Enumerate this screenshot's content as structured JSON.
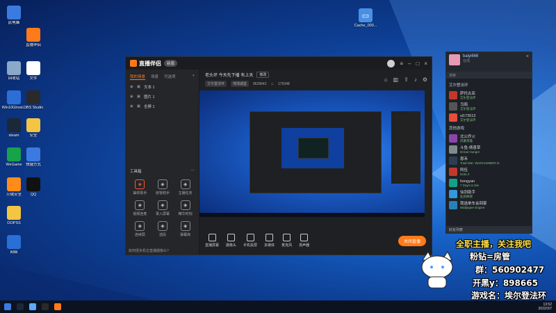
{
  "desktop": {
    "icons_left": [
      {
        "label": "此电脑",
        "color": "#3b7be0"
      },
      {
        "label": "回收站",
        "color": "#8aa8c8"
      },
      {
        "label": "Win10Ghost...",
        "color": "#2b6fd6"
      },
      {
        "label": "steam",
        "color": "#1b2838"
      },
      {
        "label": "WeGame",
        "color": "#16a34a"
      },
      {
        "label": "火绒安全",
        "color": "#ff8c1a"
      },
      {
        "label": "OOPSS",
        "color": "#f4c542"
      },
      {
        "label": "网络",
        "color": "#2a6fd6"
      }
    ],
    "icons_right": [
      {
        "label": "直播伴侣",
        "color": "#ff7a1a"
      },
      {
        "label": "文件",
        "color": "#ffffff"
      },
      {
        "label": "OBS Studio",
        "color": "#2a2a2a"
      },
      {
        "label": "安全",
        "color": "#f4c542"
      },
      {
        "label": "快捷方式",
        "color": "#3b7be0"
      },
      {
        "label": "QQ",
        "color": "#111111"
      }
    ],
    "top_file": "Cache_000..."
  },
  "app": {
    "name": "直播伴侣",
    "version": "新版",
    "left_tabs": [
      "我的场景",
      "场景",
      "可选项"
    ],
    "scenes": [
      "文本 1",
      "图片 1",
      "全屏 1"
    ],
    "tools_title": "工具箱",
    "tools": [
      {
        "label": "抽奖助手",
        "hot": true
      },
      {
        "label": "房管助手",
        "hot": false
      },
      {
        "label": "主播任务",
        "hot": false
      },
      {
        "label": "视频连麦",
        "hot": false
      },
      {
        "label": "录入屏幕",
        "hot": false
      },
      {
        "label": "精华时刻",
        "hot": false
      },
      {
        "label": "连续屏",
        "hot": false
      },
      {
        "label": "选段",
        "hot": false
      },
      {
        "label": "弹幕库",
        "hot": false
      }
    ],
    "notice": "如何把多机位直播摄像头?",
    "room_title": "老头环 今天先下播 有上天",
    "room_edit": "修改",
    "room_tags": [
      "艾尔登法环",
      "地球城堡"
    ],
    "room_id": "9629642",
    "viewers": "179348",
    "bottom_tools": [
      "直播屏幕",
      "摄像头",
      "手机投屏",
      "多媒体",
      "麦克风",
      "扬声器"
    ],
    "live_button": "关闭直播"
  },
  "qq": {
    "nickname": "baiyi666",
    "status": "在线",
    "search_placeholder": "搜索",
    "group1": "艾尔登法环",
    "contacts1": [
      {
        "name": "萨托古亚",
        "status": "艾尔登法环"
      },
      {
        "name": "乌鸦",
        "status": "艾尔登法环"
      },
      {
        "name": "sl173513",
        "status": "艾尔登法环"
      }
    ],
    "group2": "其他游戏",
    "contacts2": [
      {
        "name": "北公乔火",
        "status": "风暴英雄"
      },
      {
        "name": "斗鱼-倩喜草",
        "status": "Dread Hunger"
      },
      {
        "name": "恩禾",
        "status": "Total War: WARHAMMER III"
      },
      {
        "name": "阿伍",
        "status": "Dota 2"
      },
      {
        "name": "hongyan",
        "status": "7 Days to Die"
      },
      {
        "name": "仙剑助手",
        "status": "仙剑奇侠"
      },
      {
        "name": "我选单车会回家",
        "status": "Wallpaper Engine"
      }
    ],
    "footer": "好友列表"
  },
  "overlay": {
    "line1": "全职主播，关注我吧",
    "line2": "粉钻=房管",
    "line3": "群：560902477",
    "line4": "开黑y：898665",
    "line5": "游戏名：埃尔登法环"
  },
  "taskbar": {
    "time": "13:52",
    "date": "2022/3/7"
  }
}
